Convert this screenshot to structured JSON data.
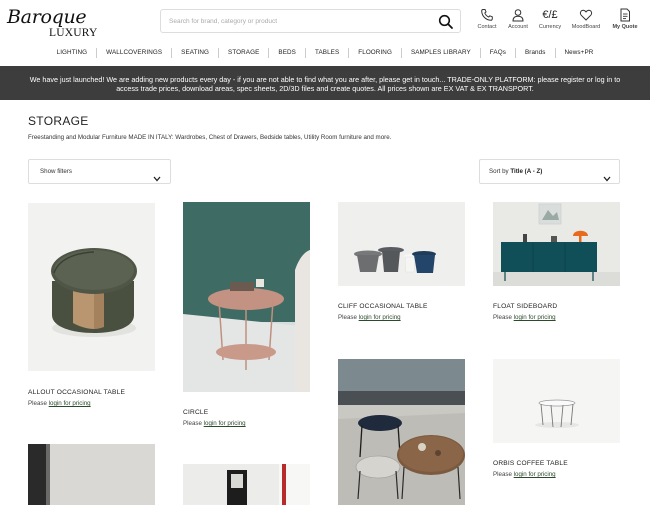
{
  "header": {
    "logo_main": "Baroque",
    "logo_sub": "LUXURY",
    "search_placeholder": "Search for brand, category or product",
    "icons": [
      {
        "name": "phone-icon",
        "label": "Contact"
      },
      {
        "name": "account-icon",
        "label": "Account"
      },
      {
        "name": "currency-icon",
        "label": "Currency",
        "glyph": "€/£"
      },
      {
        "name": "heart-icon",
        "label": "MoodBoard"
      },
      {
        "name": "quote-icon",
        "label": "My Quote"
      }
    ]
  },
  "nav": {
    "items": [
      "LIGHTING",
      "WALLCOVERINGS",
      "SEATING",
      "STORAGE",
      "BEDS",
      "TABLES",
      "FLOORING",
      "SAMPLES LIBRARY",
      "FAQs",
      "Brands",
      "News+PR"
    ]
  },
  "banner": {
    "text": "We have just launched! We are adding new products every day - if you are not able to find what you are after, please get in touch... TRADE-ONLY PLATFORM: please register or log in to access trade prices, download areas, spec sheets, 2D/3D files and create quotes. All prices shown are EX VAT & EX TRANSPORT."
  },
  "page": {
    "title": "STORAGE",
    "description": "Freestanding and Modular Furniture MADE IN ITALY: Wardrobes, Chest of Drawers, Bedside tables, Utility Room furniture and more."
  },
  "filters": {
    "show_filters_label": "Show filters",
    "sort_prefix": "Sort by",
    "sort_value": "Title (A - Z)"
  },
  "pricing": {
    "prefix": "Please",
    "link": "login for pricing"
  },
  "products": [
    {
      "name": "ALLOUT OCCASIONAL TABLE"
    },
    {
      "name": "CIRCLE"
    },
    {
      "name": "CLIFF OCCASIONAL TABLE"
    },
    {
      "name": "FLOAT SIDEBOARD"
    },
    {
      "name": "ORBIS COFFEE TABLE"
    }
  ],
  "colors": {
    "banner_bg": "#3d3d3d",
    "link_green": "#2c4a2c"
  }
}
